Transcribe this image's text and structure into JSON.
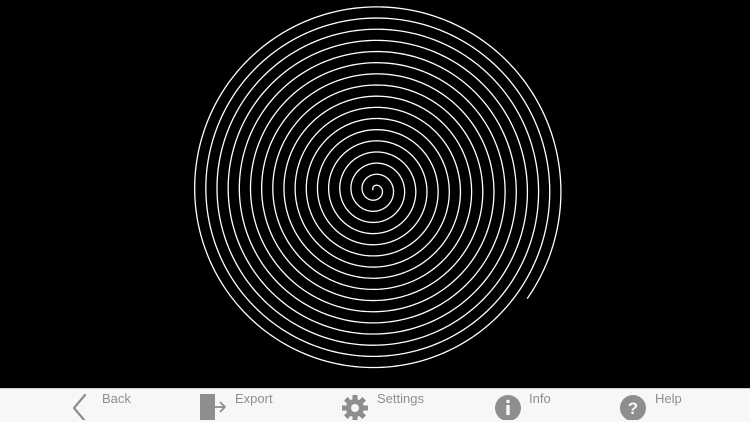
{
  "canvas": {
    "background": "#000000",
    "stroke_color": "#ffffff",
    "spiral": {
      "type": "archimedean",
      "turns": 16.75
    }
  },
  "toolbar": {
    "background": "#f7f7f7",
    "icon_color": "#8e8e8e",
    "items": [
      {
        "label": "Back",
        "icon": "chevron-left-icon"
      },
      {
        "label": "Export",
        "icon": "export-icon"
      },
      {
        "label": "Settings",
        "icon": "gear-icon"
      },
      {
        "label": "Info",
        "icon": "info-icon"
      },
      {
        "label": "Help",
        "icon": "help-icon"
      }
    ]
  }
}
